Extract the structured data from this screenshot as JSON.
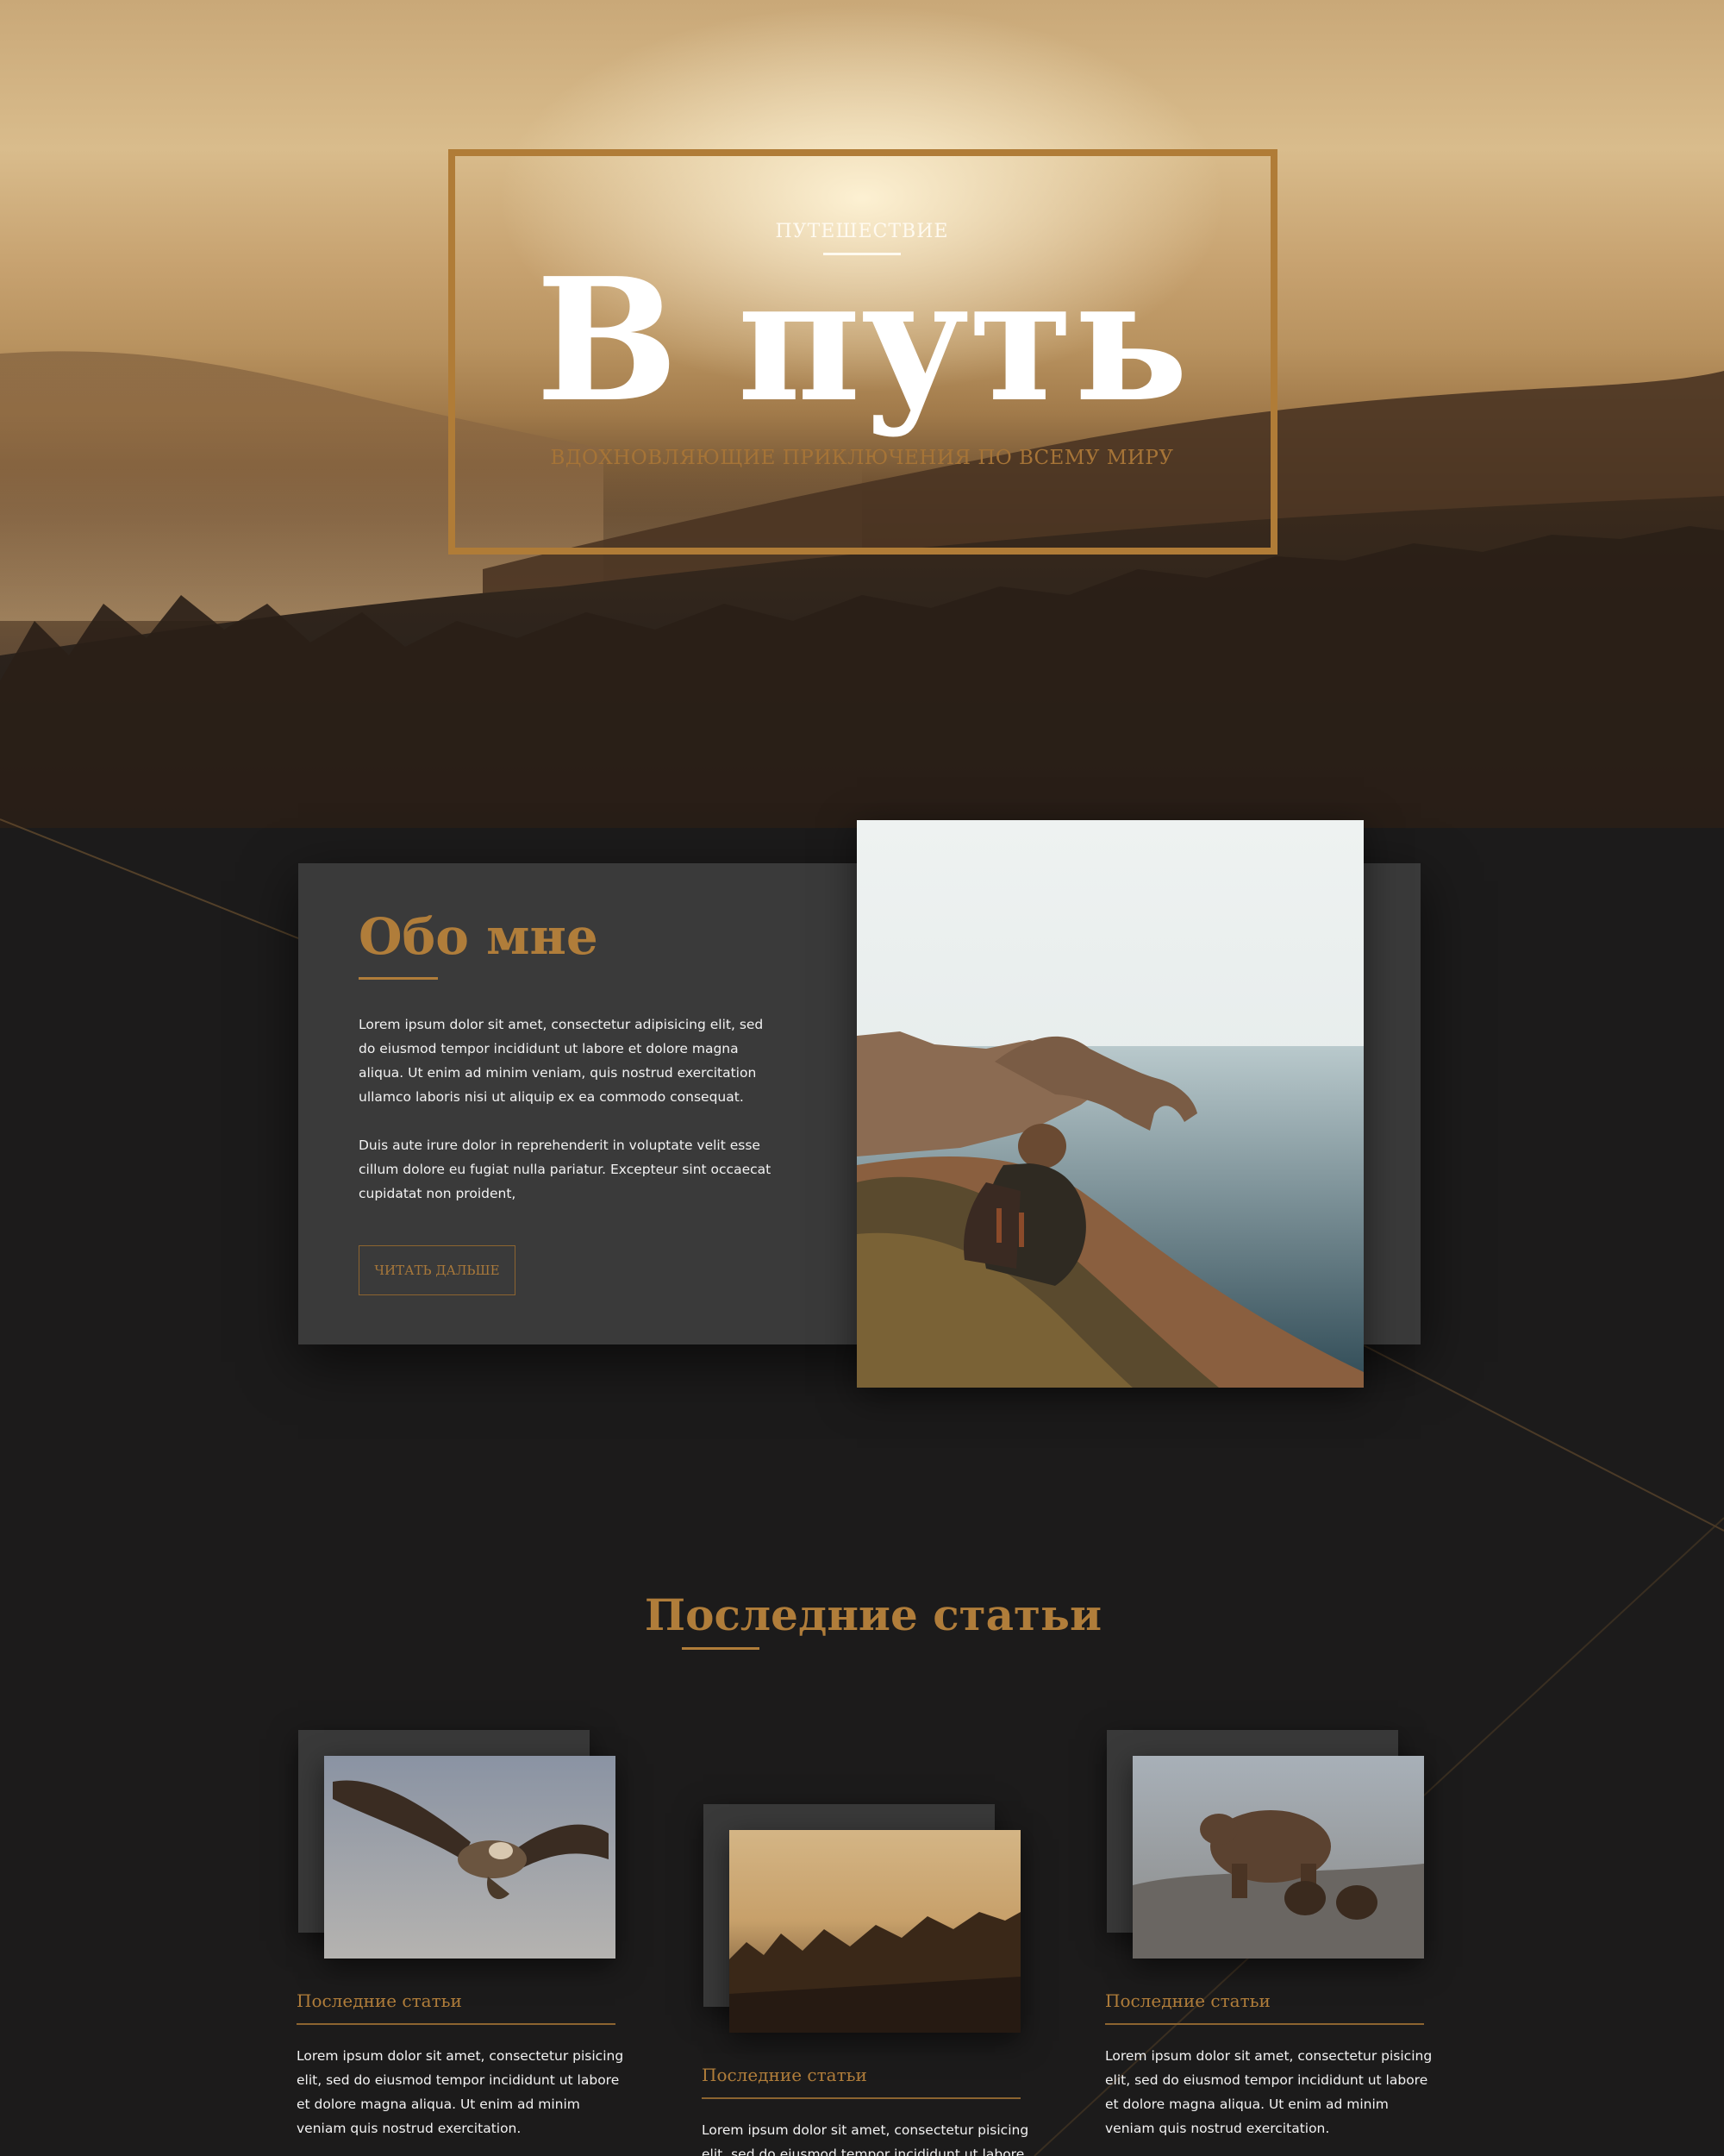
{
  "hero": {
    "kicker": "ПУТЕШЕСТВИЕ",
    "title": "В путь",
    "tagline": "ВДОХНОВЛЯЮЩИЕ ПРИКЛЮЧЕНИЯ ПО ВСЕМУ МИРУ"
  },
  "about": {
    "title": "Обо мне",
    "paragraph1": "Lorem ipsum dolor sit amet, consectetur adipisicing elit, sed do eiusmod tempor incididunt ut labore et dolore magna aliqua. Ut enim ad minim veniam, quis nostrud exercitation ullamco laboris nisi ut aliquip ex ea commodo consequat.",
    "paragraph2": "Duis aute irure dolor in reprehenderit in voluptate velit esse cillum dolore eu fugiat nulla pariatur. Excepteur sint occaecat cupidatat non proident,",
    "button_label": "ЧИТАТЬ ДАЛЬШЕ"
  },
  "articles": {
    "section_title": "Последние статьи",
    "items": [
      {
        "title": "Последние статьи",
        "text": "Lorem ipsum dolor sit amet, consectetur pisicing elit, sed do eiusmod tempor incididunt ut labore et dolore magna aliqua. Ut enim ad minim veniam quis nostrud exercitation.",
        "image": "eagle-photo"
      },
      {
        "title": "Последние статьи",
        "text": "Lorem ipsum dolor sit amet, consectetur pisicing elit, sed do eiusmod tempor incididunt ut labore",
        "image": "forest-sunset-photo"
      },
      {
        "title": "Последние статьи",
        "text": "Lorem ipsum dolor sit amet, consectetur pisicing elit, sed do eiusmod tempor incididunt ut labore et dolore magna aliqua. Ut enim ad minim veniam quis nostrud exercitation.",
        "image": "bear-photo"
      }
    ]
  },
  "colors": {
    "accent": "#b07d3a",
    "background": "#1c1b1b",
    "card": "#3a3a3a"
  }
}
